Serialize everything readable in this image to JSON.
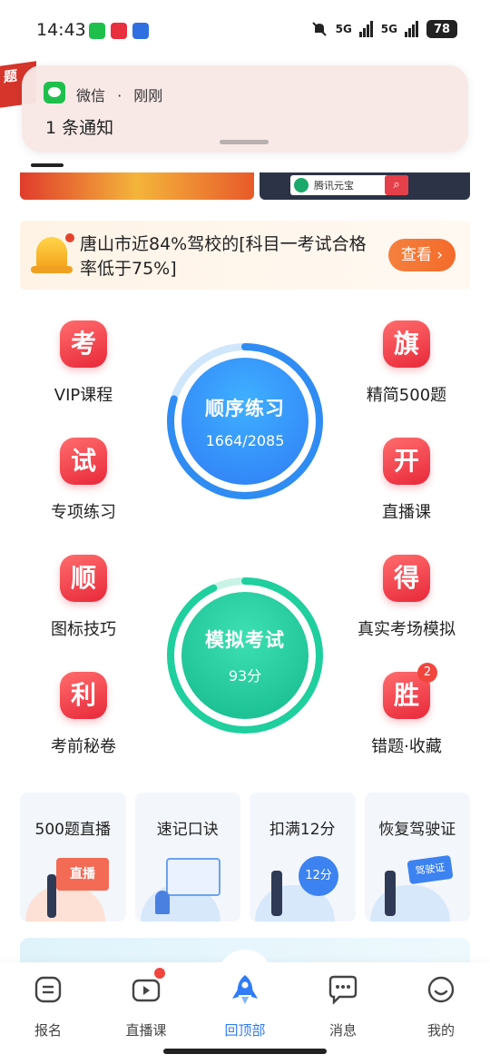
{
  "status_bar": {
    "time": "14:43",
    "signal_1": "5G",
    "signal_2": "5G",
    "battery": "78"
  },
  "background": {
    "corner_badge": "题",
    "tx_label": "腾讯元宝"
  },
  "notification": {
    "app": "微信",
    "separator": "·",
    "time": "刚刚",
    "body": "1 条通知"
  },
  "announcement": {
    "text": "唐山市近84%驾校的[科目一考试合格率低于75%]",
    "button": "查看"
  },
  "features": {
    "vip": {
      "icon_char": "考",
      "label": "VIP课程"
    },
    "jingjian": {
      "icon_char": "旗",
      "label": "精简500题"
    },
    "zhuanxiang": {
      "icon_char": "试",
      "label": "专项练习"
    },
    "zhibo": {
      "icon_char": "开",
      "label": "直播课"
    },
    "tubiao": {
      "icon_char": "顺",
      "label": "图标技巧"
    },
    "zhenshi": {
      "icon_char": "得",
      "label": "真实考场模拟"
    },
    "kaoqian": {
      "icon_char": "利",
      "label": "考前秘卷"
    },
    "cuoti": {
      "icon_char": "胜",
      "label": "错题·收藏",
      "badge": "2"
    }
  },
  "practice": {
    "title": "顺序练习",
    "progress_text": "1664/2085",
    "progress_fraction": 0.798
  },
  "exam": {
    "title": "模拟考试",
    "score_text": "93分",
    "progress_fraction": 0.93
  },
  "cards": [
    {
      "title": "500题直播",
      "art_text": "直播"
    },
    {
      "title": "速记口诀",
      "art_text": ""
    },
    {
      "title": "扣满12分",
      "art_text": "12分"
    },
    {
      "title": "恢复驾驶证",
      "art_text": "驾驶证"
    }
  ],
  "tabs": [
    {
      "label": "报名"
    },
    {
      "label": "直播课"
    },
    {
      "label": "回顶部"
    },
    {
      "label": "消息"
    },
    {
      "label": "我的"
    }
  ],
  "colors": {
    "accent_blue": "#2f7cf6",
    "accent_green": "#1fcf9e",
    "accent_red": "#e8283a",
    "accent_orange": "#f36b2a"
  }
}
